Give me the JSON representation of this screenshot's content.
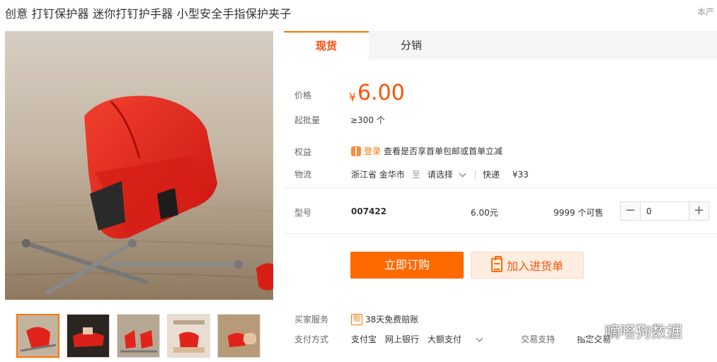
{
  "product": {
    "title": "创意 打钉保护器 迷你打钉护手器 小型安全手指保护夹子",
    "origin_tag": "本产"
  },
  "tabs": [
    {
      "label": "现货",
      "active": true
    },
    {
      "label": "分销",
      "active": false
    }
  ],
  "price": {
    "label": "价格",
    "currency": "¥",
    "value": "6.00"
  },
  "moq": {
    "label": "起批量",
    "value": "≥300 个"
  },
  "benefit": {
    "label": "权益",
    "login": "登录",
    "text": "查看是否享首单包邮或首单立减"
  },
  "logistics": {
    "label": "物流",
    "from": "浙江省 金华市",
    "to_word": "至",
    "select": "请选择",
    "method": "快递",
    "fee": "¥33"
  },
  "sku": {
    "label": "型号",
    "model": "007422",
    "unit_price": "6.00元",
    "stock": "9999 个可售",
    "quantity": "0",
    "minus": "−",
    "plus": "+"
  },
  "actions": {
    "order": "立即订购",
    "cart": "加入进货单"
  },
  "service": {
    "label": "买家服务",
    "icon_text": "赔",
    "text": "38天免费赔账"
  },
  "payment": {
    "label": "支付方式",
    "methods": [
      "支付宝",
      "网上银行",
      "大额支付"
    ]
  },
  "trade": {
    "label": "交易支持",
    "value": "指定交易"
  },
  "watermark": {
    "text": "嘀嗒狗数据",
    "icon": "wechat-icon"
  },
  "colors": {
    "accent": "#ff6a00",
    "price": "#ff5000",
    "product_red": "#e8231c"
  }
}
